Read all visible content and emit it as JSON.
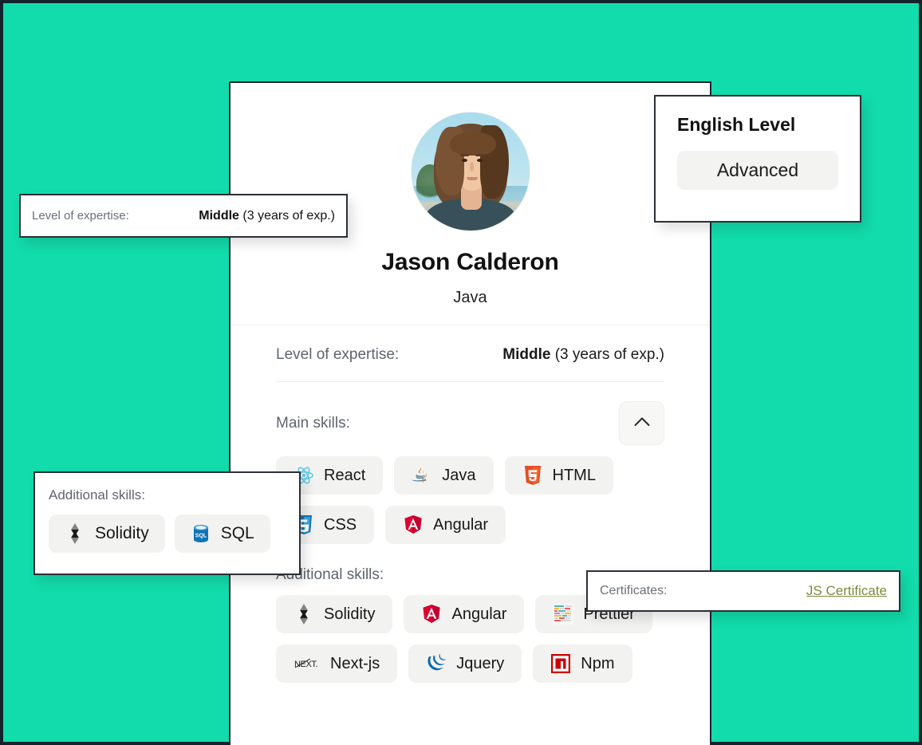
{
  "theme": {
    "background": "#12dcab",
    "page_border": "#12232b",
    "card_border": "#2b2f36",
    "chip_background": "#f2f2f0",
    "muted_text": "#5f6470",
    "link_color": "#7d8a3c"
  },
  "profile": {
    "avatar_alt": "profile-photo",
    "name": "Jason Calderon",
    "role": "Java",
    "expertise": {
      "label": "Level of expertise:",
      "level": "Middle",
      "detail": "(3 years of exp.)"
    },
    "main_skills": {
      "title": "Main skills:",
      "collapse_icon": "chevron-up-icon",
      "items": [
        {
          "label": "React",
          "icon": "react-icon"
        },
        {
          "label": "Java",
          "icon": "java-icon"
        },
        {
          "label": "HTML",
          "icon": "html5-icon"
        },
        {
          "label": "CSS",
          "icon": "css3-icon"
        },
        {
          "label": "Angular",
          "icon": "angular-icon"
        }
      ]
    },
    "additional_skills": {
      "title": "Additional skills:",
      "items": [
        {
          "label": "Solidity",
          "icon": "solidity-icon"
        },
        {
          "label": "Angular",
          "icon": "angular-icon"
        },
        {
          "label": "Prettier",
          "icon": "prettier-icon"
        },
        {
          "label": "Next-js",
          "icon": "nextjs-icon"
        },
        {
          "label": "Jquery",
          "icon": "jquery-icon"
        },
        {
          "label": "Npm",
          "icon": "npm-icon"
        }
      ]
    }
  },
  "callouts": {
    "expertise": {
      "label": "Level of expertise:",
      "level": "Middle",
      "detail": "(3 years of exp.)"
    },
    "english": {
      "title": "English Level",
      "value": "Advanced"
    },
    "additional_skills": {
      "title": "Additional skills:",
      "items": [
        {
          "label": "Solidity",
          "icon": "solidity-icon"
        },
        {
          "label": "SQL",
          "icon": "sql-icon"
        }
      ]
    },
    "certificates": {
      "label": "Certificates:",
      "link": "JS Certificate"
    }
  }
}
